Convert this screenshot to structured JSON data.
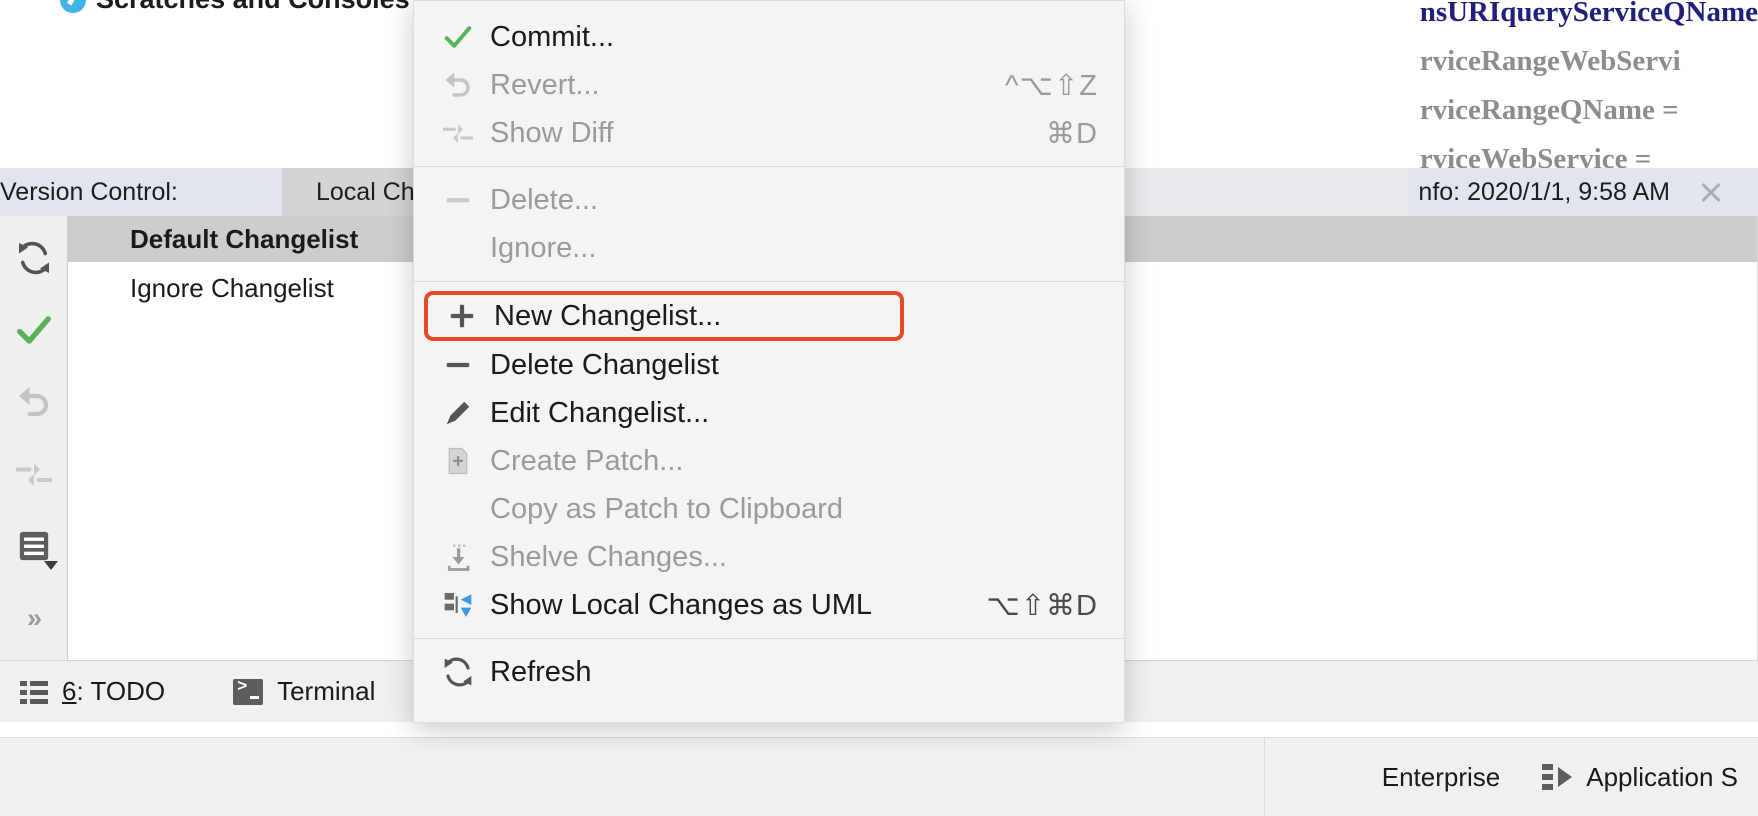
{
  "editor": {
    "project_node": "Scratches and Consoles",
    "project_node_icon": "scratch-file-icon",
    "code_lines": [
      {
        "text": "nsURIqueryServiceQName",
        "style": "navy"
      },
      {
        "text": "rviceRangeWebServi",
        "style": "grey"
      },
      {
        "text": "rviceRangeQName  =",
        "style": "grey"
      },
      {
        "text": "rviceWebService  =",
        "style": "grey"
      }
    ]
  },
  "version_control": {
    "panel_title": "Version Control:",
    "tabs": [
      {
        "label": "Local Ch"
      }
    ],
    "info_tab": {
      "label": "nfo: 2020/1/1, 9:58 AM",
      "close_icon": "close-icon"
    },
    "toolbar": [
      {
        "name": "refresh-button",
        "icon": "refresh-icon",
        "enabled": true
      },
      {
        "name": "commit-button",
        "icon": "checkmark-icon",
        "enabled": true
      },
      {
        "name": "rollback-button",
        "icon": "undo-arrow-icon",
        "enabled": false
      },
      {
        "name": "show-diff-button",
        "icon": "diff-arrows-icon",
        "enabled": false
      },
      {
        "name": "group-by-button",
        "icon": "list-group-icon",
        "enabled": true
      }
    ],
    "expand_label": "»",
    "changelists": {
      "header": "Default Changelist",
      "rows": [
        {
          "label": "Ignore Changelist"
        }
      ]
    }
  },
  "context_menu": {
    "groups": [
      {
        "items": [
          {
            "label": "Commit...",
            "icon": "checkmark-icon",
            "shortcut": "",
            "enabled": true,
            "highlighted": false
          },
          {
            "label": "Revert...",
            "icon": "undo-arrow-icon",
            "shortcut": "^⌥⇧Z",
            "enabled": false,
            "highlighted": false
          },
          {
            "label": "Show Diff",
            "icon": "diff-arrows-icon",
            "shortcut": "⌘D",
            "enabled": false,
            "highlighted": false
          }
        ]
      },
      {
        "items": [
          {
            "label": "Delete...",
            "icon": "minus-icon",
            "shortcut": "",
            "enabled": false,
            "highlighted": false
          },
          {
            "label": "Ignore...",
            "icon": "none",
            "shortcut": "",
            "enabled": false,
            "highlighted": false
          }
        ]
      },
      {
        "items": [
          {
            "label": "New Changelist...",
            "icon": "plus-icon",
            "shortcut": "",
            "enabled": true,
            "highlighted": true
          },
          {
            "label": "Delete Changelist",
            "icon": "minus-icon",
            "shortcut": "",
            "enabled": true,
            "highlighted": false
          },
          {
            "label": "Edit Changelist...",
            "icon": "pencil-icon",
            "shortcut": "",
            "enabled": true,
            "highlighted": false
          },
          {
            "label": "Create Patch...",
            "icon": "patch-icon",
            "shortcut": "",
            "enabled": false,
            "highlighted": false
          },
          {
            "label": "Copy as Patch to Clipboard",
            "icon": "none",
            "shortcut": "",
            "enabled": false,
            "highlighted": false
          },
          {
            "label": "Shelve Changes...",
            "icon": "shelve-icon",
            "shortcut": "",
            "enabled": false,
            "highlighted": false
          },
          {
            "label": "Show Local Changes as UML",
            "icon": "uml-diagram-icon",
            "shortcut": "⌥⇧⌘D",
            "enabled": true,
            "highlighted": false
          }
        ]
      },
      {
        "items": [
          {
            "label": "Refresh",
            "icon": "refresh-icon",
            "shortcut": "",
            "enabled": true,
            "highlighted": false
          }
        ]
      }
    ],
    "highlight_color": "#e8492a"
  },
  "tool_strip": {
    "todo": {
      "number": "6",
      "separator": ": ",
      "label": "TODO",
      "icon": "todo-list-icon"
    },
    "terminal": {
      "label": "Terminal",
      "icon": "terminal-icon"
    }
  },
  "status_bar": {
    "enterprise_label": "Enterprise",
    "application_servers": {
      "label": "Application S",
      "icon": "app-server-icon"
    }
  }
}
